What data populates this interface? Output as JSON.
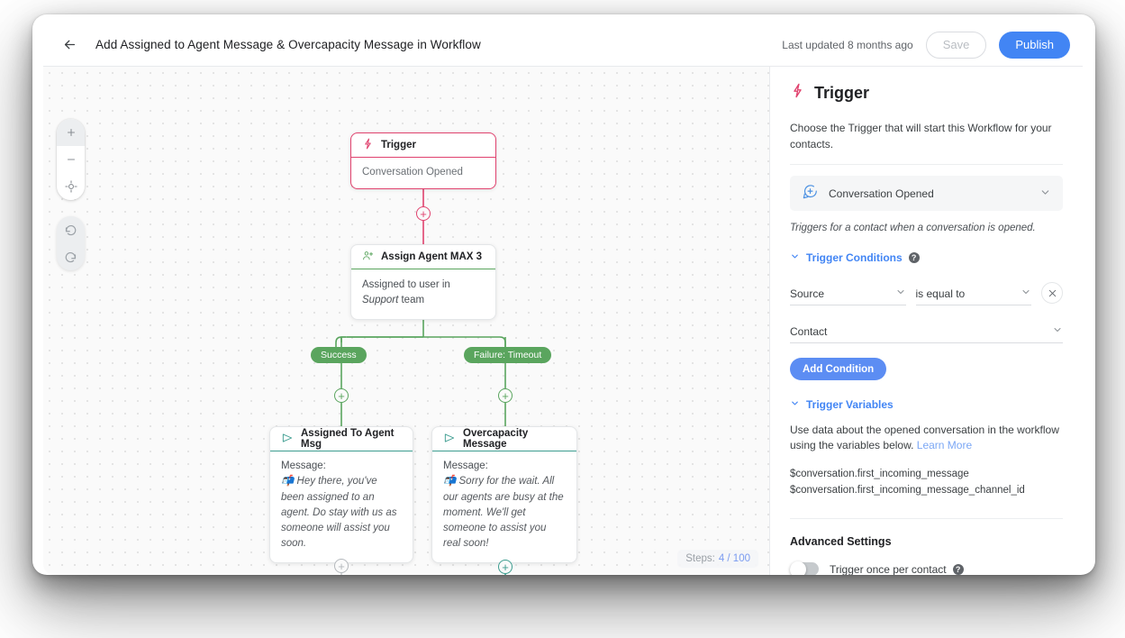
{
  "topbar": {
    "back_icon": "arrow-left-icon",
    "title": "Add Assigned to Agent Message & Overcapacity Message in Workflow",
    "last_updated": "Last updated 8 months ago",
    "save_label": "Save",
    "publish_label": "Publish"
  },
  "canvas": {
    "zoom_in_icon": "plus-icon",
    "zoom_out_icon": "minus-icon",
    "recenter_icon": "crosshair-icon",
    "undo_icon": "undo-icon",
    "redo_icon": "redo-icon",
    "steps_label": "Steps:",
    "steps_count": "4 / 100",
    "nodes": [
      {
        "id": "trigger",
        "icon": "lightning-icon",
        "title": "Trigger",
        "body": "Conversation Opened"
      },
      {
        "id": "assign-agent",
        "icon": "assign-user-icon",
        "title": "Assign Agent MAX 3",
        "body_prefix": "Assigned to user in ",
        "body_emphasis": "Support",
        "body_suffix": " team"
      },
      {
        "id": "assigned-to-agent-msg",
        "icon": "send-message-icon",
        "title": "Assigned To Agent Msg",
        "body_label": "Message:",
        "body_text": "📬 Hey there, you've been assigned to an agent. Do stay with us as someone will assist you soon."
      },
      {
        "id": "overcapacity-message",
        "icon": "send-message-icon",
        "title": "Overcapacity Message",
        "body_label": "Message:",
        "body_text": "📬 Sorry for the wait. All our agents are busy at the moment. We'll get someone to assist you real soon!"
      }
    ],
    "branches": [
      {
        "id": "success",
        "label": "Success"
      },
      {
        "id": "failure-timeout",
        "label": "Failure: Timeout"
      }
    ],
    "add_step_icon": "plus-circle-icon"
  },
  "panel": {
    "icon": "lightning-icon",
    "title": "Trigger",
    "description": "Choose the Trigger that will start this Workflow for your contacts.",
    "trigger_select": {
      "icon": "chat-plus-icon",
      "value": "Conversation Opened",
      "chevron": "chevron-down-icon"
    },
    "trigger_note": "Triggers for a contact when a conversation is opened.",
    "conditions_section": {
      "toggle_icon": "chevron-down-icon",
      "label": "Trigger Conditions",
      "help_icon": "help-icon",
      "field_label": "Source",
      "operator_label": "is equal to",
      "value_label": "Contact",
      "remove_icon": "close-icon",
      "add_condition_label": "Add Condition"
    },
    "variables_section": {
      "toggle_icon": "chevron-down-icon",
      "label": "Trigger Variables",
      "description": "Use data about the opened conversation in the workflow using the variables below.",
      "learn_more_label": "Learn More",
      "variables": [
        "$conversation.first_incoming_message",
        "$conversation.first_incoming_message_channel_id"
      ]
    },
    "advanced_section": {
      "title": "Advanced Settings",
      "toggle_label": "Trigger once per contact",
      "toggle_state": "off",
      "help_icon": "help-icon"
    }
  },
  "colors": {
    "accent_blue": "#4285f4",
    "trigger_pink": "#e0426e",
    "branch_green": "#5aa55e",
    "message_teal": "#3c9c8f",
    "muted_grey": "#b4b8bc"
  }
}
